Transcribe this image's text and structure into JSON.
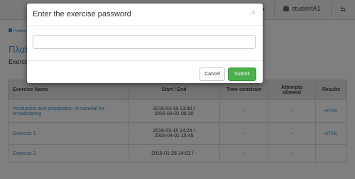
{
  "topbar": {
    "user_label": "studentA1",
    "icons": [
      "bell-icon",
      "user-icon",
      "settings-sliders-icon"
    ]
  },
  "page": {
    "breadcrumb": "Portfolio",
    "course_title": "Πλατφόρμα",
    "section_title": "Exercises"
  },
  "table": {
    "headers": {
      "name": "Exercise Name",
      "start_end": "Start / End",
      "time": "Time constrain",
      "attempts": "Attempts allowed",
      "results": "Results"
    },
    "rows": [
      {
        "name": "Production and preparation of material for broadcasting",
        "start": "2016-03-15 13:40 /",
        "end": "2016-03-31 06:30",
        "time": "-",
        "attempts": "-",
        "results": "HTML"
      },
      {
        "name": "Exercise 1",
        "start": "2016-03-15 14:24 /",
        "end": "2016-04-01 15:45",
        "time": "-",
        "attempts": "-",
        "results": "HTML"
      },
      {
        "name": "Exercise 2",
        "start": "2016-01-26 14:03 / -",
        "end": "",
        "time": "-",
        "attempts": "-",
        "results": ""
      }
    ]
  },
  "modal": {
    "title": "Enter the exercise password",
    "close": "×",
    "password_value": "",
    "cancel_label": "Cancel",
    "submit_label": "Submit"
  },
  "colors": {
    "link": "#3a8ed0",
    "submit": "#4cae4c"
  }
}
